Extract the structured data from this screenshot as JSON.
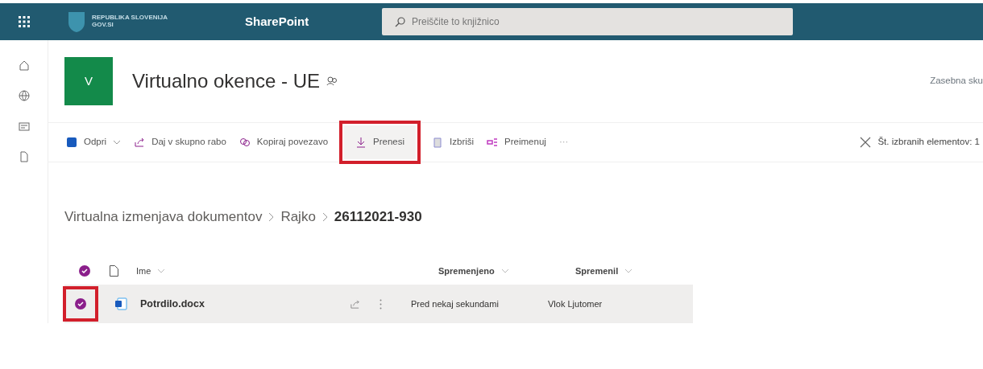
{
  "top_bar": {
    "org_name": "REPUBLIKA SLOVENIJA",
    "org_site": "GOV.SI",
    "app_name": "SharePoint",
    "search": {
      "placeholder": "Preiščite to knjižnico"
    }
  },
  "rail": [
    {
      "kind": "home"
    },
    {
      "kind": "globe"
    },
    {
      "kind": "news"
    },
    {
      "kind": "file"
    }
  ],
  "site": {
    "tile": "V",
    "title": "Virtualno okence - UE",
    "privacy": "Zasebna sku"
  },
  "commands": [
    {
      "label": "Odpri",
      "kind": "word",
      "dropdown": true,
      "highlighted": false
    },
    {
      "label": "Daj v skupno rabo",
      "kind": "share",
      "dropdown": false,
      "highlighted": false
    },
    {
      "label": "Kopiraj povezavo",
      "kind": "link",
      "dropdown": false,
      "highlighted": false
    },
    {
      "label": "Prenesi",
      "kind": "download",
      "dropdown": false,
      "highlighted": true
    },
    {
      "label": "Izbriši",
      "kind": "delete",
      "dropdown": false,
      "highlighted": false
    },
    {
      "label": "Preimenuj",
      "kind": "rename",
      "dropdown": false,
      "highlighted": false
    },
    {
      "label": "···",
      "kind": "more",
      "dropdown": false,
      "highlighted": false
    }
  ],
  "selection": {
    "label": "Št. izbranih elementov: 1"
  },
  "breadcrumb": [
    {
      "label": "Virtualna izmenjava dokumentov",
      "current": false
    },
    {
      "label": "Rajko",
      "current": false
    },
    {
      "label": "26112021-930",
      "current": true
    }
  ],
  "table": {
    "all_selected": true,
    "columns": [
      "Ime",
      "Spremenjeno",
      "Spremenil"
    ],
    "rows": [
      {
        "selected": true,
        "highlighted": true,
        "name": "Potrdilo.docx",
        "modified": "Pred nekaj sekundami",
        "modified_by": "Vlok Ljutomer"
      }
    ]
  }
}
